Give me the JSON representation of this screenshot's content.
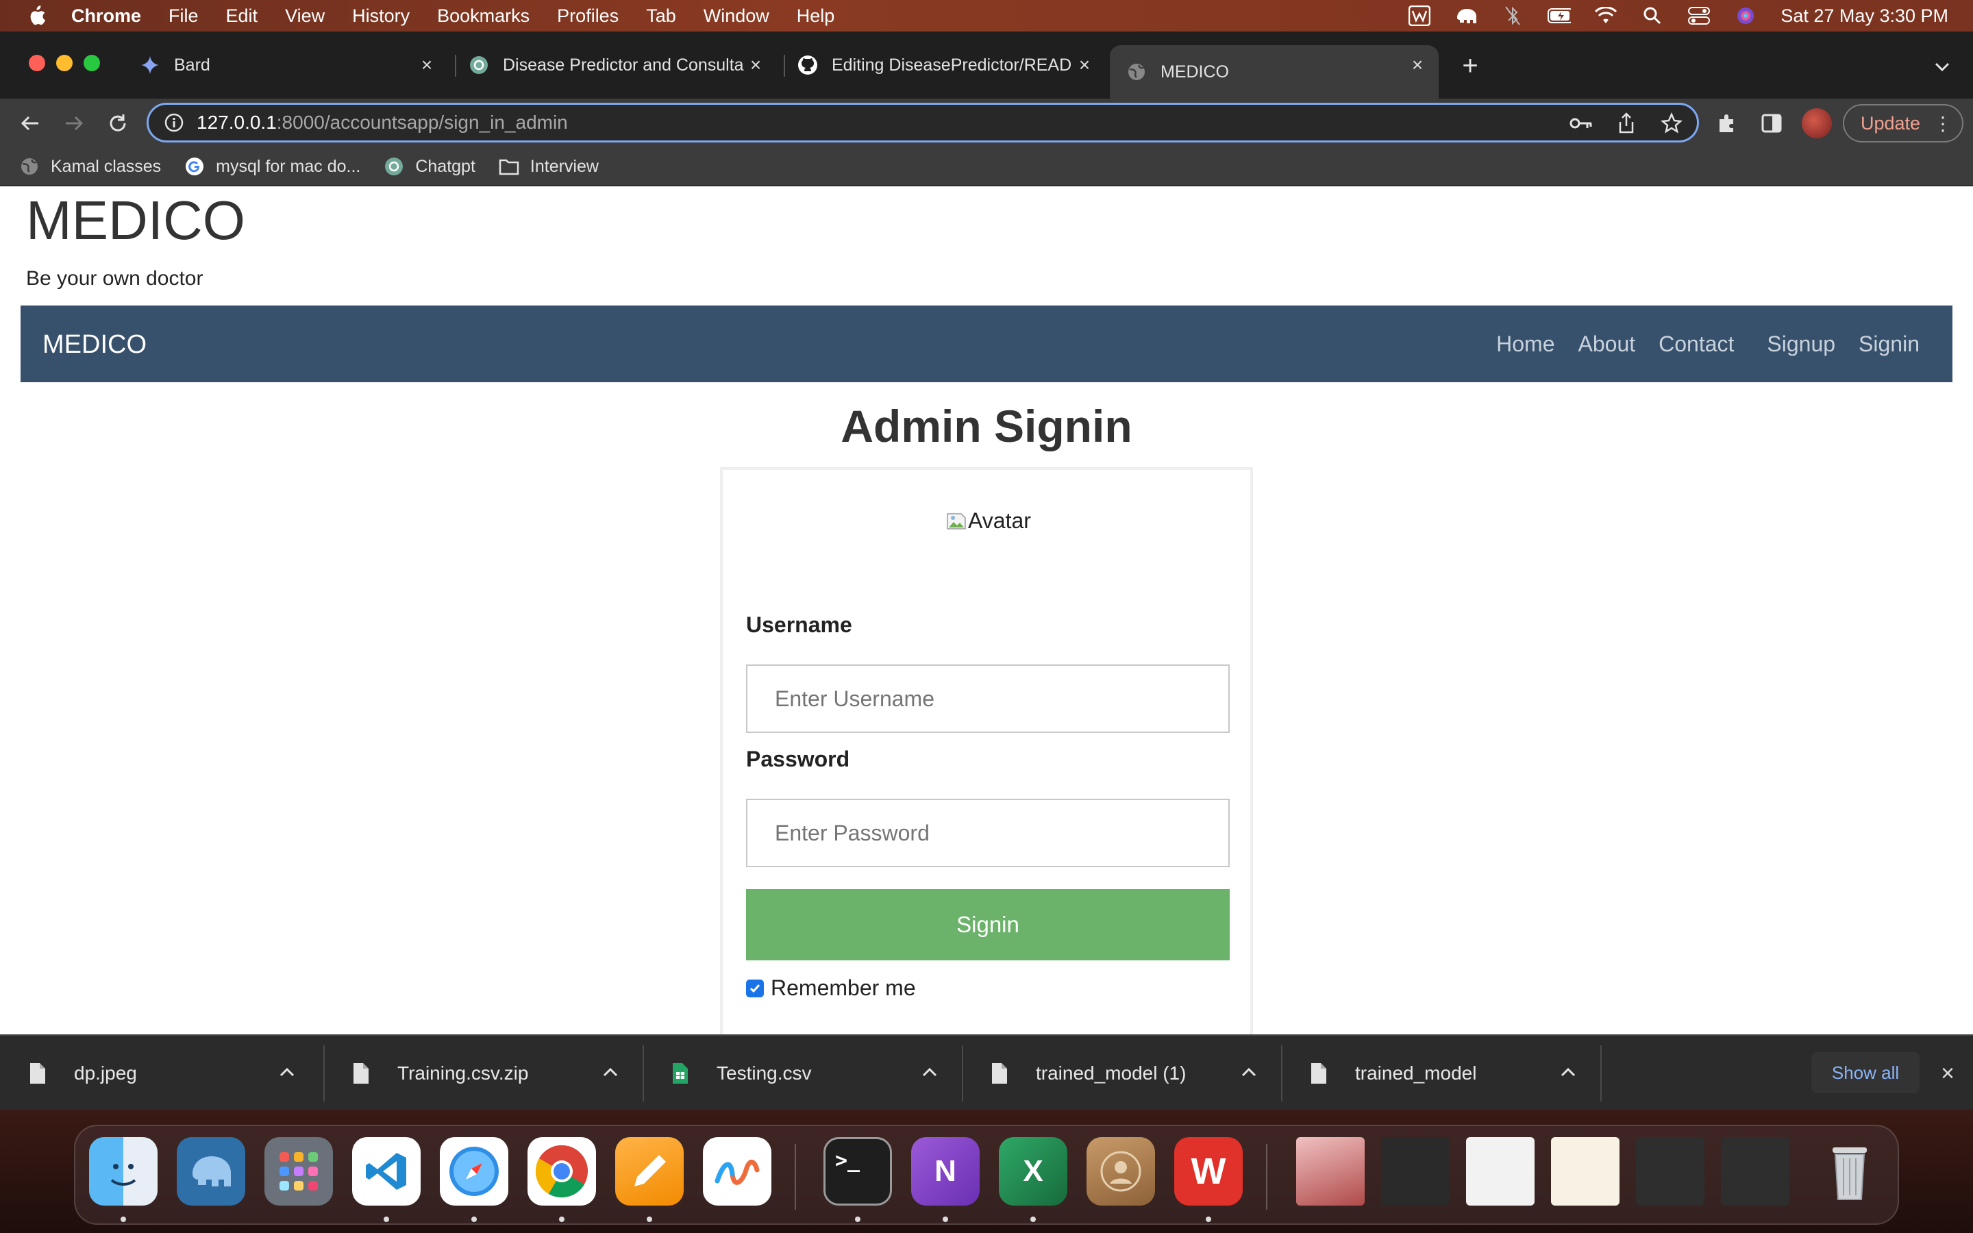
{
  "menubar": {
    "app": "Chrome",
    "items": [
      "File",
      "Edit",
      "View",
      "History",
      "Bookmarks",
      "Profiles",
      "Tab",
      "Window",
      "Help"
    ],
    "datetime": "Sat 27 May  3:30 PM"
  },
  "tabs": [
    {
      "title": "Bard",
      "icon": "bard-icon"
    },
    {
      "title": "Disease Predictor and Consulta",
      "icon": "chatgpt-icon"
    },
    {
      "title": "Editing DiseasePredictor/READ",
      "icon": "github-icon"
    },
    {
      "title": "MEDICO",
      "icon": "globe-icon",
      "active": true
    }
  ],
  "omnibox": {
    "host": "127.0.0.1",
    "path": ":8000/accountsapp/sign_in_admin"
  },
  "toolbar": {
    "update_label": "Update"
  },
  "bookmarks": [
    {
      "label": "Kamal classes",
      "icon": "globe-icon"
    },
    {
      "label": "mysql for mac do...",
      "icon": "google-icon"
    },
    {
      "label": "Chatgpt",
      "icon": "chatgpt-icon"
    },
    {
      "label": "Interview",
      "icon": "folder-icon"
    }
  ],
  "page": {
    "site_title": "MEDICO",
    "tagline": "Be your own doctor",
    "navbar": {
      "brand": "MEDICO",
      "links": [
        "Home",
        "About",
        "Contact",
        "Signup",
        "Signin"
      ]
    },
    "form": {
      "heading": "Admin Signin",
      "avatar_alt": "Avatar",
      "username_label": "Username",
      "username_placeholder": "Enter Username",
      "password_label": "Password",
      "password_placeholder": "Enter Password",
      "submit_label": "Signin",
      "remember_label": "Remember me",
      "remember_checked": true,
      "button_color": "#6bb26a"
    },
    "navbar_color": "#37506c"
  },
  "downloads": {
    "items": [
      {
        "name": "dp.jpeg",
        "icon": "file-icon"
      },
      {
        "name": "Training.csv.zip",
        "icon": "file-icon"
      },
      {
        "name": "Testing.csv",
        "icon": "sheets-file-icon"
      },
      {
        "name": "trained_model (1)",
        "icon": "file-icon"
      },
      {
        "name": "trained_model",
        "icon": "file-icon"
      }
    ],
    "show_all_label": "Show all"
  },
  "dock": [
    {
      "name": "finder",
      "label": "",
      "color": "#4aa3f0"
    },
    {
      "name": "tableplus",
      "label": "",
      "color": "#1f5f9a"
    },
    {
      "name": "launchpad",
      "label": "",
      "color": "#8a8f98"
    },
    {
      "name": "vscode",
      "label": "",
      "color": "#ffffff"
    },
    {
      "name": "safari",
      "label": "",
      "color": "#3b8fe0"
    },
    {
      "name": "chrome",
      "label": "",
      "color": "#ffffff"
    },
    {
      "name": "pages",
      "label": "",
      "color": "#f5a623"
    },
    {
      "name": "freeform",
      "label": "",
      "color": "#ffffff"
    },
    {
      "name": "terminal",
      "label": ">_",
      "color": "#1e1e1e"
    },
    {
      "name": "onenote",
      "label": "N",
      "color": "#7a3fbf"
    },
    {
      "name": "excel",
      "label": "X",
      "color": "#1d7a45"
    },
    {
      "name": "contacts",
      "label": "",
      "color": "#b88a5a"
    },
    {
      "name": "wps",
      "label": "W",
      "color": "#e0312b"
    }
  ]
}
